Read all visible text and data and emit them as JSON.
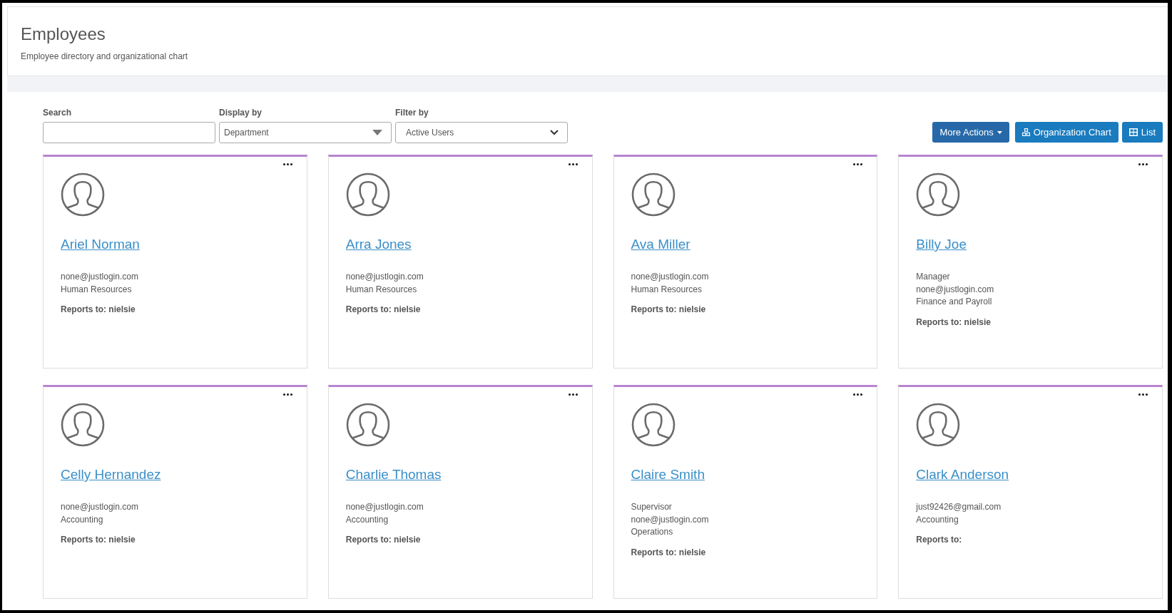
{
  "header": {
    "title": "Employees",
    "subtitle": "Employee directory and organizational chart"
  },
  "filters": [
    {
      "kind": "text",
      "label": "Search"
    },
    {
      "kind": "dropdown",
      "label": "Display by",
      "value": "Department"
    },
    {
      "kind": "select",
      "label": "Filter by",
      "value": "Active Users"
    }
  ],
  "actions": [
    {
      "kind": "menu",
      "label": "More Actions"
    },
    {
      "kind": "orgchart",
      "label": "Organization Chart"
    },
    {
      "kind": "list",
      "label": "List"
    }
  ],
  "employees": [
    {
      "name": "Ariel Norman",
      "details": [
        "none@justlogin.com",
        "Human Resources"
      ],
      "reports_to": "Reports to: nielsie"
    },
    {
      "name": "Arra Jones",
      "details": [
        "none@justlogin.com",
        "Human Resources"
      ],
      "reports_to": "Reports to: nielsie"
    },
    {
      "name": "Ava Miller",
      "details": [
        "none@justlogin.com",
        "Human Resources"
      ],
      "reports_to": "Reports to: nielsie"
    },
    {
      "name": "Billy Joe",
      "details": [
        "Manager",
        "none@justlogin.com",
        "Finance and Payroll"
      ],
      "reports_to": "Reports to: nielsie"
    },
    {
      "name": "Celly Hernandez",
      "details": [
        "none@justlogin.com",
        "Accounting"
      ],
      "reports_to": "Reports to: nielsie"
    },
    {
      "name": "Charlie Thomas",
      "details": [
        "none@justlogin.com",
        "Accounting"
      ],
      "reports_to": "Reports to: nielsie"
    },
    {
      "name": "Claire Smith",
      "details": [
        "Supervisor",
        "none@justlogin.com",
        "Operations"
      ],
      "reports_to": "Reports to: nielsie"
    },
    {
      "name": "Clark Anderson",
      "details": [
        "just92426@gmail.com",
        "Accounting"
      ],
      "reports_to": "Reports to:"
    }
  ]
}
